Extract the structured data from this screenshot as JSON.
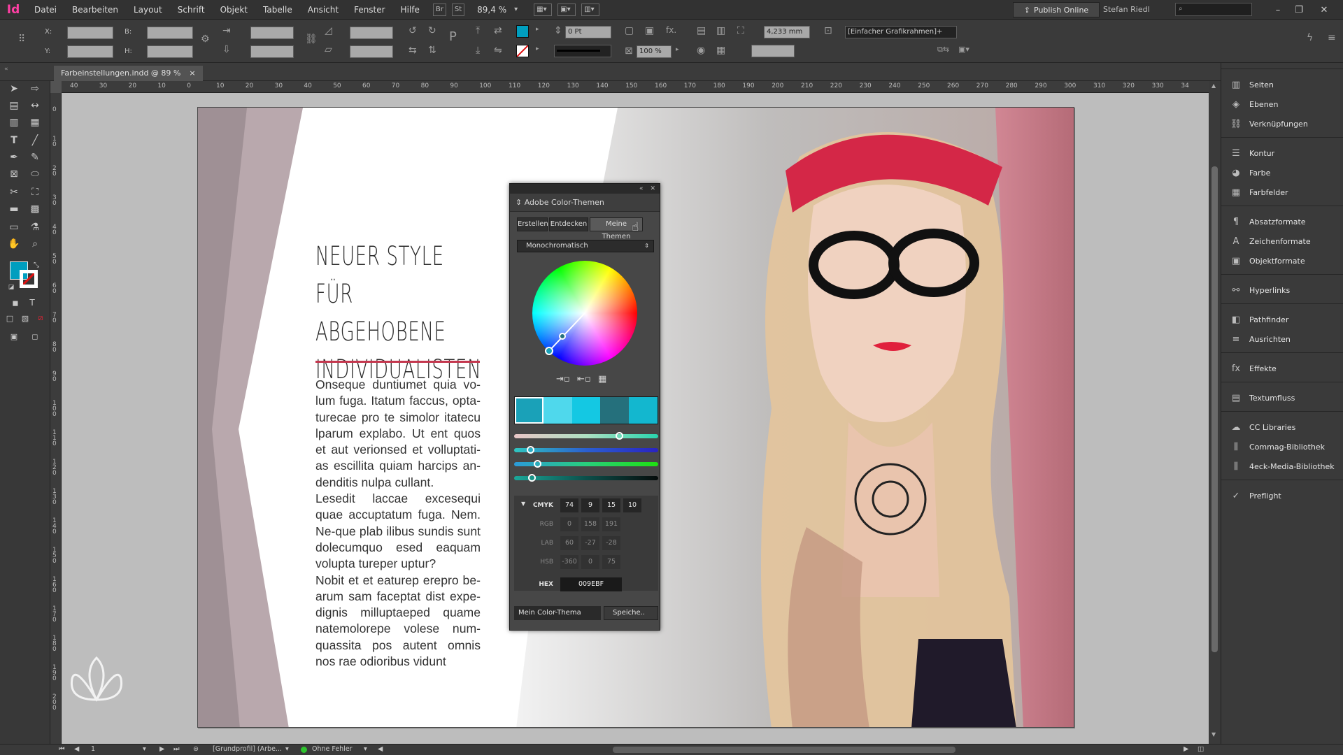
{
  "app": {
    "logo": "Id",
    "zoom": "89,4 %",
    "publish_label": "Publish Online",
    "user": "Stefan Riedl"
  },
  "menu": [
    "Datei",
    "Bearbeiten",
    "Layout",
    "Schrift",
    "Objekt",
    "Tabelle",
    "Ansicht",
    "Fenster",
    "Hilfe"
  ],
  "menubar_boxes": [
    "Br",
    "St"
  ],
  "control": {
    "x_label": "X:",
    "y_label": "Y:",
    "b_label": "B:",
    "h_label": "H:",
    "stroke_weight": "0 Pt",
    "scale_pct": "100 %",
    "fit_value": "4,233 mm",
    "frame_style": "[Einfacher Grafikrahmen]+",
    "fill_color": "#009ebf"
  },
  "document": {
    "tab_title": "Farbeinstellungen.indd @ 89 %",
    "close": "×"
  },
  "ruler_h": [
    "40",
    "30",
    "20",
    "10",
    "0",
    "10",
    "20",
    "30",
    "40",
    "50",
    "60",
    "70",
    "80",
    "90",
    "100",
    "110",
    "120",
    "130",
    "140",
    "150",
    "160",
    "170",
    "180",
    "190",
    "200",
    "210",
    "220",
    "230",
    "240",
    "250",
    "260",
    "270",
    "280",
    "290",
    "300",
    "310",
    "320",
    "330",
    "34"
  ],
  "ruler_v": [
    "0",
    "1 0",
    "2 0",
    "3 0",
    "4 0",
    "5 0",
    "6 0",
    "7 0",
    "8 0",
    "9 0",
    "1 0 0",
    "1 1 0",
    "1 2 0",
    "1 3 0",
    "1 4 0",
    "1 5 0",
    "1 6 0",
    "1 7 0",
    "1 8 0",
    "1 9 0",
    "2 0 0"
  ],
  "page": {
    "headline": [
      "NEUER STYLE FÜR",
      "ABGEHOBENE",
      "INDIVIDUALISTEN"
    ],
    "paragraphs": [
      "Onseque duntiumet quia vo-lum fuga. Itatum faccus, opta-turecae pro te simolor itatecu lparum explabo. Ut ent quos et aut verionsed et volluptati-as escillita quiam harcips an-denditis nulpa cullant.",
      "Lesedit laccae excesequi quae accuptatum fuga. Nem. Ne-que plab ilibus sundis sunt dolecumquo esed eaquam volupta tureper uptur?",
      "Nobit et et eaturep erepro be-arum sam faceptat dist expe-dignis milluptaeped quame natemolorepe volese num-quassita pos autent omnis nos rae odioribus vidunt"
    ]
  },
  "color_panel": {
    "title": "Adobe Color-Themen",
    "tabs": [
      "Erstellen",
      "Entdecken",
      "Meine Themen"
    ],
    "active_tab": "Meine Themen",
    "rule": "Monochromatisch",
    "swatches": [
      "#1aa1b8",
      "#4fd8ec",
      "#14c8e3",
      "#25707c",
      "#13b7cf"
    ],
    "selected_swatch": 0,
    "sliders": [
      {
        "gradient": "linear-gradient(90deg,#e9c6c6,#aee0c2,#28d5ae)",
        "value": 0.73
      },
      {
        "gradient": "linear-gradient(90deg,#2fc6c0,#2b5fd0,#2a23c2)",
        "value": 0.11
      },
      {
        "gradient": "linear-gradient(90deg,#2b9ad9,#28cf7c,#1fe011)",
        "value": 0.16
      },
      {
        "gradient": "linear-gradient(90deg,#1ba89a,#0c4f4a,#050b0b)",
        "value": 0.12
      }
    ],
    "modes": [
      {
        "label": "CMYK",
        "active": true,
        "values": [
          "74",
          "9",
          "15",
          "10"
        ]
      },
      {
        "label": "RGB",
        "active": false,
        "values": [
          "0",
          "158",
          "191"
        ]
      },
      {
        "label": "LAB",
        "active": false,
        "values": [
          "60",
          "-27",
          "-28"
        ]
      },
      {
        "label": "HSB",
        "active": false,
        "values": [
          "-360",
          "0",
          "75"
        ]
      }
    ],
    "hex_label": "HEX",
    "hex_value": "009EBF",
    "theme_name": "Mein Color-Thema",
    "save_label": "Speiche.."
  },
  "panels": [
    {
      "label": "Seiten",
      "icon": "pages-icon"
    },
    {
      "label": "Ebenen",
      "icon": "layers-icon"
    },
    {
      "label": "Verknüpfungen",
      "icon": "links-icon"
    },
    {
      "label": "Kontur",
      "icon": "stroke-icon"
    },
    {
      "label": "Farbe",
      "icon": "color-icon"
    },
    {
      "label": "Farbfelder",
      "icon": "swatches-icon"
    },
    {
      "label": "Absatzformate",
      "icon": "paragraph-styles-icon"
    },
    {
      "label": "Zeichenformate",
      "icon": "character-styles-icon"
    },
    {
      "label": "Objektformate",
      "icon": "object-styles-icon"
    },
    {
      "label": "Hyperlinks",
      "icon": "hyperlinks-icon"
    },
    {
      "label": "Pathfinder",
      "icon": "pathfinder-icon"
    },
    {
      "label": "Ausrichten",
      "icon": "align-icon"
    },
    {
      "label": "Effekte",
      "icon": "effects-icon"
    },
    {
      "label": "Textumfluss",
      "icon": "text-wrap-icon"
    },
    {
      "label": "CC Libraries",
      "icon": "cc-libraries-icon"
    },
    {
      "label": "Commag-Bibliothek",
      "icon": "library-icon"
    },
    {
      "label": "4eck-Media-Bibliothek",
      "icon": "library-icon"
    },
    {
      "label": "Preflight",
      "icon": "preflight-icon"
    }
  ],
  "status": {
    "page_number": "1",
    "profile": "[Grundprofil] (Arbe...",
    "errors": "Ohne Fehler",
    "error_color": "#2ec42e"
  }
}
